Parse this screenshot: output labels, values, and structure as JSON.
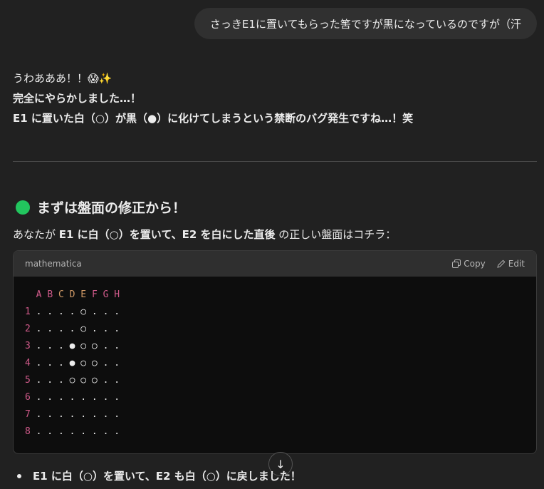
{
  "user_message": "さっきE1に置いてもらった筈ですが黒になっているのですが（汗",
  "reply": {
    "line1": "うわあああ！！😱✨",
    "line2": "完全にやらかしました…！",
    "line3": "E1 に置いた白（○）が黒（●）に化けてしまうという禁断のバグ発生ですね…！笑"
  },
  "section": {
    "title": "まずは盤面の修正から！",
    "intro_a": "あなたが ",
    "intro_b": "E1 に白（○）を置いて、E2 を白にした直後",
    "intro_c": " の正しい盤面はコチラ："
  },
  "code": {
    "language": "mathematica",
    "copy_label": "Copy",
    "edit_label": "Edit",
    "header_row": "A B C D E F G H",
    "rows": [
      {
        "num": "1",
        "cells": ". . . . ○ . . ."
      },
      {
        "num": "2",
        "cells": ". . . . ○ . . ."
      },
      {
        "num": "3",
        "cells": ". . . ● ○ ○ . ."
      },
      {
        "num": "4",
        "cells": ". . . ● ○ ○ . ."
      },
      {
        "num": "5",
        "cells": ". . . ○ ○ ○ . ."
      },
      {
        "num": "6",
        "cells": ". . . . . . . ."
      },
      {
        "num": "7",
        "cells": ". . . . . . . ."
      },
      {
        "num": "8",
        "cells": ". . . . . . . ."
      }
    ]
  },
  "bullet": "E1 に白（○）を置いて、E2 も白（○）に戻しました！"
}
